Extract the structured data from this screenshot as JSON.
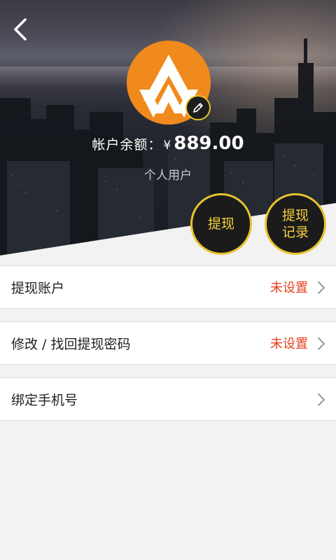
{
  "header": {
    "balance_label": "帐户余额：",
    "currency_symbol": "¥",
    "balance_amount": "889.00",
    "user_type": "个人用户"
  },
  "actions": {
    "withdraw_label": "提现",
    "records_label": "提现\n记录"
  },
  "settings": [
    {
      "label": "提现账户",
      "status": "未设置"
    },
    {
      "label": "修改 / 找回提现密码",
      "status": "未设置"
    },
    {
      "label": "绑定手机号",
      "status": ""
    }
  ],
  "colors": {
    "accent": "#e9c42c",
    "status": "#e8401c",
    "avatar": "#f08a1c"
  },
  "icons": {
    "back": "chevron-left-icon",
    "edit": "pencil-icon",
    "row_arrow": "chevron-right-icon"
  }
}
